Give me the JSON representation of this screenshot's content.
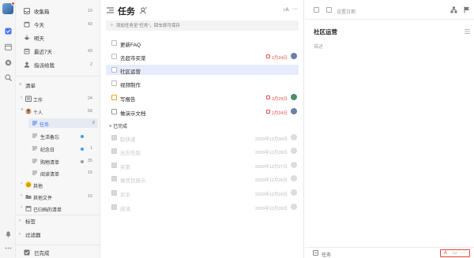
{
  "sidebar": {
    "smart_lists": [
      {
        "label": "收集箱",
        "count": "19",
        "icon": "inbox-icon"
      },
      {
        "label": "今天",
        "count": "43",
        "icon": "calendar-today-icon"
      },
      {
        "label": "明天",
        "count": "",
        "icon": "sun-icon"
      },
      {
        "label": "最近7天",
        "count": "43",
        "icon": "calendar-week-icon"
      },
      {
        "label": "指派给我",
        "count": "2",
        "icon": "person-icon"
      }
    ],
    "lists_header": "清单",
    "lists": [
      {
        "label": "工作",
        "count": "24"
      },
      {
        "label": "个人",
        "count": "58"
      }
    ],
    "personal_items": [
      {
        "label": "任务",
        "count": "8",
        "dot": ""
      },
      {
        "label": "生活备忘",
        "count": "",
        "dot": "#3aa0e8"
      },
      {
        "label": "纪念日",
        "count": "1",
        "dot": "#3aa0e8"
      },
      {
        "label": "购物清单",
        "count": "35",
        "dot": "#999999"
      },
      {
        "label": "阅读清单",
        "count": "16",
        "dot": ""
      }
    ],
    "other_group": {
      "label": "其他"
    },
    "other_items": [
      {
        "label": "其他文件",
        "count": "10"
      },
      {
        "label": "已归档的清单",
        "count": ""
      }
    ],
    "tags_label": "标签",
    "filters_label": "过滤器",
    "completed_label": "已完成"
  },
  "main": {
    "title": "任务",
    "add_placeholder": "添加任务至\"任务\"，回车即可保存",
    "tasks": [
      {
        "label": "更新FAQ",
        "date": ""
      },
      {
        "label": "去超市买菜",
        "date": "2月24日"
      },
      {
        "label": "社区运营",
        "date": ""
      },
      {
        "label": "视频制作",
        "date": ""
      },
      {
        "label": "写报告",
        "date": "3月29日"
      },
      {
        "label": "做演示文档",
        "date": "2月24日"
      }
    ],
    "completed_header": "已完成",
    "completed": [
      {
        "label": "取快递",
        "date": "2020年12月30日"
      },
      {
        "label": "出去吃饭",
        "date": "2020年12月28日"
      },
      {
        "label": "买菜",
        "date": "2020年12月27日"
      },
      {
        "label": "做项目展示",
        "date": "2020年12月26日"
      },
      {
        "label": "买伞",
        "date": "2020年12月26日"
      },
      {
        "label": "阅读",
        "date": "2020年12月26日"
      }
    ]
  },
  "detail": {
    "set_date": "设置日期",
    "title": "社区运营",
    "description_placeholder": "描述",
    "footer_list": "任务"
  },
  "colors": {
    "accent": "#4772fa",
    "overdue": "#e5534b",
    "highlight": "#e0463a"
  }
}
